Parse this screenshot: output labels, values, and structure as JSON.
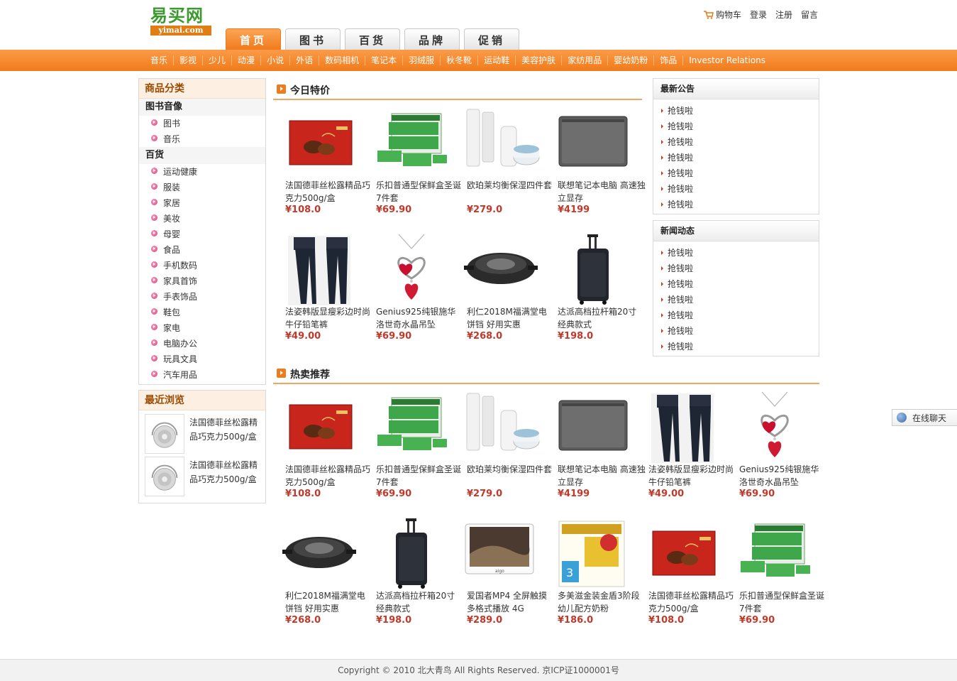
{
  "logo": {
    "cn": "易买网",
    "en": "yimai.com"
  },
  "toplinks": [
    "购物车",
    "登录",
    "注册",
    "留言"
  ],
  "tabs": [
    "首页",
    "图书",
    "百货",
    "品牌",
    "促销"
  ],
  "nav": [
    "音乐",
    "影视",
    "少儿",
    "动漫",
    "小说",
    "外语",
    "数码相机",
    "笔记本",
    "羽绒服",
    "秋冬靴",
    "运动鞋",
    "美容护肤",
    "家纺用品",
    "婴幼奶粉",
    "饰品",
    "Investor Relations"
  ],
  "categories": {
    "title": "商品分类",
    "groups": [
      {
        "name": "图书音像",
        "items": [
          "图书",
          "音乐"
        ]
      },
      {
        "name": "百货",
        "items": [
          "运动健康",
          "服装",
          "家居",
          "美妆",
          "母婴",
          "食品",
          "手机数码",
          "家具首饰",
          "手表饰品",
          "鞋包",
          "家电",
          "电脑办公",
          "玩具文具",
          "汽车用品"
        ]
      }
    ]
  },
  "recent": {
    "title": "最近浏览",
    "items": [
      {
        "name": "法国德菲丝松露精品巧克力500g/盒",
        "icon": "headphones-icon"
      },
      {
        "name": "法国德菲丝松露精品巧克力500g/盒",
        "icon": "headphones-icon"
      }
    ]
  },
  "today": {
    "title": "今日特价",
    "products": [
      {
        "name": "法国德菲丝松露精品巧克力500g/盒",
        "price": "¥108.0",
        "icon": "chocolate-box-icon"
      },
      {
        "name": "乐扣普通型保鲜盒圣诞7件套",
        "price": "¥69.90",
        "icon": "food-container-icon"
      },
      {
        "name": "欧珀莱均衡保湿四件套",
        "price": "¥279.0",
        "icon": "cosmetics-icon"
      },
      {
        "name": "联想笔记本电脑 高速独立显存",
        "price": "¥4199",
        "icon": "laptop-icon"
      },
      {
        "name": "法姿韩版显瘦彩边时尚牛仔铅笔裤",
        "price": "¥49.00",
        "icon": "jeans-icon"
      },
      {
        "name": "Genius925纯银施华洛世奇水晶吊坠",
        "price": "¥69.90",
        "icon": "heart-pendant-icon"
      },
      {
        "name": "利仁2018M福满堂电饼铛 好用实惠",
        "price": "¥268.0",
        "icon": "griddle-icon"
      },
      {
        "name": "达派高档拉杆箱20寸 经典款式",
        "price": "¥198.0",
        "icon": "suitcase-icon"
      }
    ]
  },
  "hot": {
    "title": "热卖推荐",
    "products": [
      {
        "name": "法国德菲丝松露精品巧克力500g/盒",
        "price": "¥108.0",
        "icon": "chocolate-box-icon"
      },
      {
        "name": "乐扣普通型保鲜盒圣诞7件套",
        "price": "¥69.90",
        "icon": "food-container-icon"
      },
      {
        "name": "欧珀莱均衡保湿四件套",
        "price": "¥279.0",
        "icon": "cosmetics-icon"
      },
      {
        "name": "联想笔记本电脑 高速独立显存",
        "price": "¥4199",
        "icon": "laptop-icon"
      },
      {
        "name": "法姿韩版显瘦彩边时尚牛仔铅笔裤",
        "price": "¥49.00",
        "icon": "jeans-icon"
      },
      {
        "name": "Genius925纯银施华洛世奇水晶吊坠",
        "price": "¥69.90",
        "icon": "heart-pendant-icon"
      },
      {
        "name": "利仁2018M福满堂电饼铛 好用实惠",
        "price": "¥268.0",
        "icon": "griddle-icon"
      },
      {
        "name": "达派高档拉杆箱20寸 经典款式",
        "price": "¥198.0",
        "icon": "suitcase-icon"
      },
      {
        "name": "爱国者MP4 全屏触摸多格式播放 4G",
        "price": "¥289.0",
        "icon": "mp4-player-icon"
      },
      {
        "name": "多美滋金装金盾3阶段幼儿配方奶粉",
        "price": "¥186.0",
        "icon": "milk-powder-icon"
      },
      {
        "name": "法国德菲丝松露精品巧克力500g/盒",
        "price": "¥108.0",
        "icon": "chocolate-box-icon"
      },
      {
        "name": "乐扣普通型保鲜盒圣诞7件套",
        "price": "¥69.90",
        "icon": "food-container-icon"
      }
    ]
  },
  "notice": {
    "title": "最新公告",
    "items": [
      "抢钱啦",
      "抢钱啦",
      "抢钱啦",
      "抢钱啦",
      "抢钱啦",
      "抢钱啦",
      "抢钱啦"
    ]
  },
  "news": {
    "title": "新闻动态",
    "items": [
      "抢钱啦",
      "抢钱啦",
      "抢钱啦",
      "抢钱啦",
      "抢钱啦",
      "抢钱啦",
      "抢钱啦"
    ]
  },
  "chat": {
    "label": "在线聊天"
  },
  "footer": "Copyright © 2010 北大青鸟 All Rights Reserved. 京ICP证1000001号",
  "colors": {
    "accent": "#f07b1b",
    "price": "#c0392b",
    "logo_green": "#3a9a2c"
  }
}
